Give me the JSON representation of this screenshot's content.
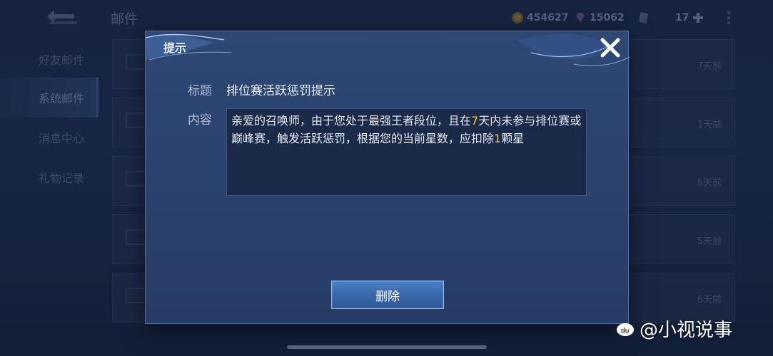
{
  "header": {
    "title": "邮件",
    "gold": "454627",
    "gems": "15062",
    "tickets": "17"
  },
  "sidebar": {
    "items": [
      {
        "label": "好友邮件"
      },
      {
        "label": "系统邮件"
      },
      {
        "label": "消息中心"
      },
      {
        "label": "礼物记录"
      }
    ],
    "active": "系统邮件"
  },
  "mail_list": [
    {
      "time": "7天前"
    },
    {
      "time": "1天前"
    },
    {
      "time": "5天前"
    },
    {
      "time": "5天前"
    },
    {
      "time": "6天前"
    }
  ],
  "dialog": {
    "header": "提示",
    "title_label": "标题",
    "title_value": "排位赛活跃惩罚提示",
    "content_label": "内容",
    "content_parts": {
      "p1": "亲爱的召唤师，由于您处于最强王者段位，且在",
      "days": "7",
      "p2": "天内未参与排位赛或巅峰赛，触发活跃惩罚，根据您的当前星数，应扣除",
      "stars": "1",
      "p3": "颗星"
    },
    "delete_label": "删除"
  },
  "watermark": "@小视说事",
  "colors": {
    "highlight": "#f2c94c",
    "modal_bg": "#2a416c",
    "button": "#3a68ad"
  }
}
